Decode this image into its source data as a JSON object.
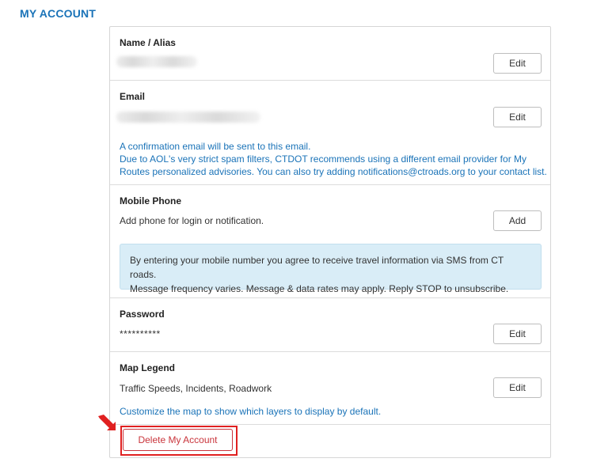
{
  "page_title": "MY ACCOUNT",
  "name_section": {
    "label": "Name / Alias",
    "edit_label": "Edit"
  },
  "email_section": {
    "label": "Email",
    "edit_label": "Edit",
    "note_line1": "A confirmation email will be sent to this email.",
    "note_line2": "Due to AOL's very strict spam filters, CTDOT recommends using a different email provider for My",
    "note_line3": "Routes personalized advisories. You can also try adding notifications@ctroads.org to your contact list."
  },
  "phone_section": {
    "label": "Mobile Phone",
    "value": "Add phone for login or notification.",
    "add_label": "Add",
    "info_line1": "By entering your mobile number you agree to receive travel information via SMS from CT roads.",
    "info_line2": "Message frequency varies. Message & data rates may apply. Reply STOP to unsubscribe."
  },
  "password_section": {
    "label": "Password",
    "value": "**********",
    "edit_label": "Edit"
  },
  "map_legend_section": {
    "label": "Map Legend",
    "value": "Traffic Speeds, Incidents, Roadwork",
    "edit_label": "Edit",
    "customize_link": "Customize the map to show which layers to display by default."
  },
  "delete_label": "Delete My Account",
  "colors": {
    "accent": "#1a73b8",
    "danger": "#c9343b",
    "highlight": "#e02020",
    "info_bg": "#d9edf7"
  },
  "icons": {
    "pointer": "red-arrow-icon"
  }
}
